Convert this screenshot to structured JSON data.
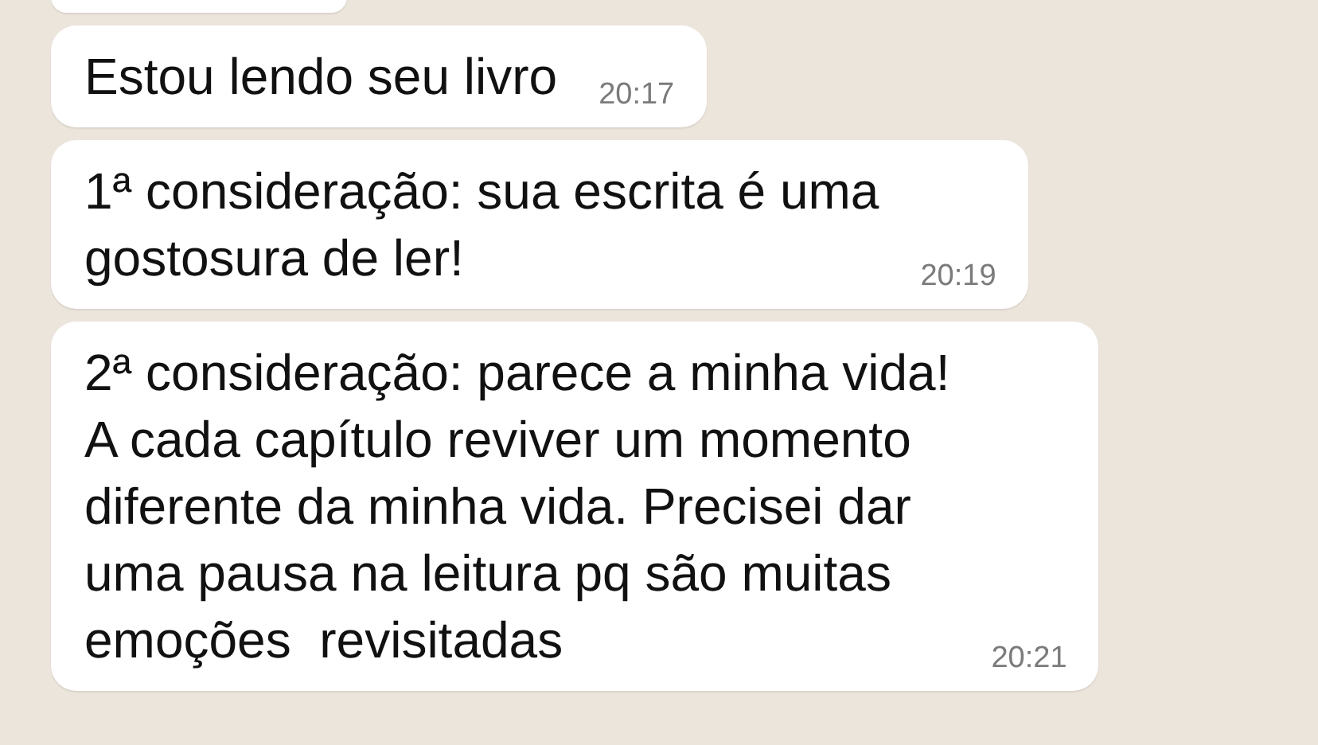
{
  "messages": [
    {
      "text": "Estou lendo seu livro",
      "time": "20:17"
    },
    {
      "text": "1ª consideração: sua escrita é uma\ngostosura de ler!",
      "time": "20:19"
    },
    {
      "text": "2ª consideração: parece a minha vida!\nA cada capítulo reviver um momento\ndiferente da minha vida. Precisei dar\numa pausa na leitura pq são muitas\nemoções  revisitadas",
      "time": "20:21"
    }
  ]
}
